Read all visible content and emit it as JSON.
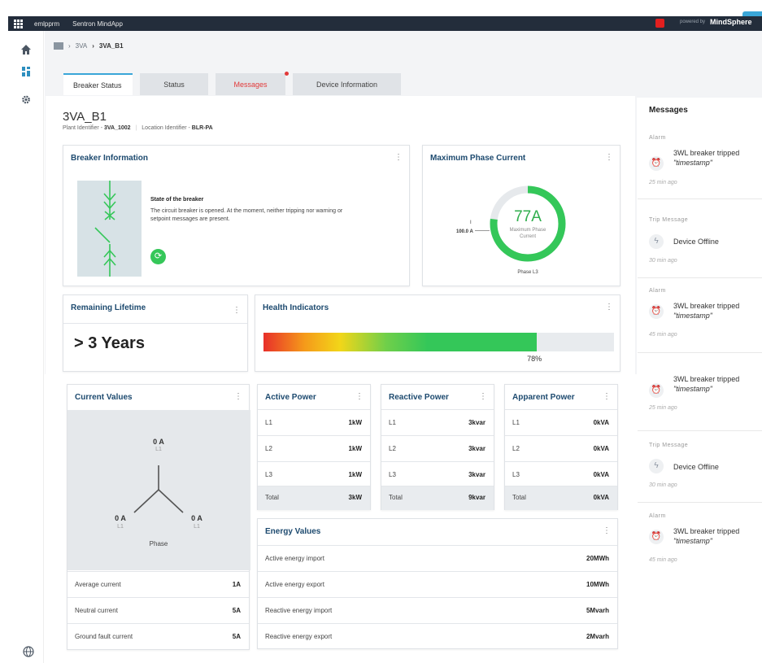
{
  "topbar": {
    "tenant": "emlpprm",
    "app": "Sentron MindApp",
    "powered": "powered by",
    "brand": "MindSphere"
  },
  "breadcrumb": {
    "parent": "3VA",
    "current": "3VA_B1"
  },
  "tabs": [
    {
      "label": "Breaker Status",
      "active": true
    },
    {
      "label": "Status"
    },
    {
      "label": "Messages",
      "alert": true
    },
    {
      "label": "Device Information"
    }
  ],
  "device": {
    "name": "3VA_B1",
    "plant_label": "Plant Identifier - ",
    "plant_value": "3VA_1002",
    "location_label": "Location Identifier - ",
    "location_value": "BLR-PA"
  },
  "breaker_info": {
    "title": "Breaker Information",
    "state_title": "State of the breaker",
    "state_desc": "The circuit breaker is opened. At the moment, neither tripping nor warning or setpoint messages are present."
  },
  "max_phase": {
    "title": "Maximum Phase Current",
    "value": "77A",
    "label": "Maximum Phase Current",
    "i_label": "I",
    "limit": "100.0 A",
    "phase": "Phase L3",
    "fraction": 0.77
  },
  "lifetime": {
    "title": "Remaining Lifetime",
    "value": "> 3 Years"
  },
  "health": {
    "title": "Health Indicators",
    "percent_label": "78%",
    "percent": 78
  },
  "current_values": {
    "title": "Current Values",
    "top": {
      "value": "0 A",
      "label": "L1"
    },
    "left": {
      "value": "0 A",
      "label": "L1"
    },
    "right": {
      "value": "0 A",
      "label": "L1"
    },
    "phase_label": "Phase",
    "rows": [
      {
        "k": "Average current",
        "v": "1A"
      },
      {
        "k": "Neutral current",
        "v": "5A"
      },
      {
        "k": "Ground fault current",
        "v": "5A"
      }
    ]
  },
  "active_power": {
    "title": "Active Power",
    "rows": [
      {
        "k": "L1",
        "v": "1kW"
      },
      {
        "k": "L2",
        "v": "1kW"
      },
      {
        "k": "L3",
        "v": "1kW"
      }
    ],
    "total": {
      "k": "Total",
      "v": "3kW"
    }
  },
  "reactive_power": {
    "title": "Reactive Power",
    "rows": [
      {
        "k": "L1",
        "v": "3kvar"
      },
      {
        "k": "L2",
        "v": "3kvar"
      },
      {
        "k": "L3",
        "v": "3kvar"
      }
    ],
    "total": {
      "k": "Total",
      "v": "9kvar"
    }
  },
  "apparent_power": {
    "title": "Apparent Power",
    "rows": [
      {
        "k": "L1",
        "v": "0kVA"
      },
      {
        "k": "L2",
        "v": "0kVA"
      },
      {
        "k": "L3",
        "v": "0kVA"
      }
    ],
    "total": {
      "k": "Total",
      "v": "0kVA"
    }
  },
  "energy": {
    "title": "Energy Values",
    "rows": [
      {
        "k": "Active energy import",
        "v": "20MWh"
      },
      {
        "k": "Active energy export",
        "v": "10MWh"
      },
      {
        "k": "Reactive energy import",
        "v": "5Mvarh"
      },
      {
        "k": "Reactive energy export",
        "v": "2Mvarh"
      }
    ]
  },
  "messages": {
    "title": "Messages",
    "items": [
      {
        "type": "Alarm",
        "text": "3WL breaker tripped",
        "sub": "\"timestamp\"",
        "time": "25 min ago"
      },
      {
        "type": "Trip Message",
        "text": "Device Offline",
        "sub": "",
        "time": "30 min ago"
      },
      {
        "type": "Alarm",
        "text": "3WL breaker tripped",
        "sub": "\"timestamp\"",
        "time": "45 min ago"
      },
      {
        "type": "",
        "text": "3WL breaker tripped",
        "sub": "\"timestamp\"",
        "time": "25 min ago"
      },
      {
        "type": "Trip Message",
        "text": "Device Offline",
        "sub": "",
        "time": "30 min ago"
      },
      {
        "type": "Alarm",
        "text": "3WL breaker tripped",
        "sub": "\"timestamp\"",
        "time": "45 min ago"
      }
    ]
  },
  "icons": {
    "grid": "apps-grid-icon",
    "home": "home-icon",
    "dashboard": "dashboard-icon",
    "settings": "gear-icon",
    "globe": "globe-icon",
    "alarm": "alarm-clock-icon",
    "trip": "lightning-icon",
    "refresh": "refresh-icon"
  },
  "colors": {
    "accent": "#3aa6d8",
    "green": "#34c759",
    "title_blue": "#1d4a6f",
    "alarm_red": "#e04848"
  }
}
